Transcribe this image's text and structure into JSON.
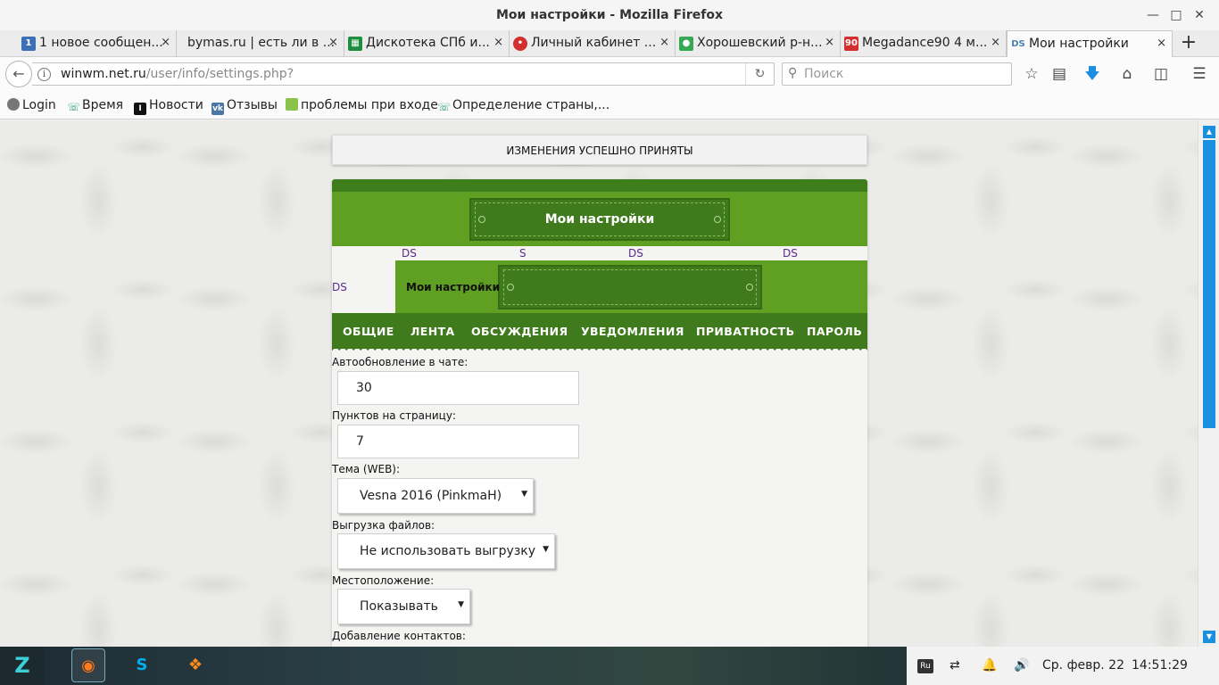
{
  "window": {
    "title": "Мои настройки - Mozilla Firefox",
    "minimize_icon": "minimize-icon",
    "maximize_icon": "maximize-icon",
    "close_icon": "close-icon"
  },
  "tabs": [
    {
      "label": "1 новое сообщен...",
      "favicon": "1",
      "favicon_color": "#3b6fb6"
    },
    {
      "label": "bymas.ru | есть ли в ...",
      "favicon": "",
      "favicon_color": ""
    },
    {
      "label": "Дискотека СПб и...",
      "favicon": "",
      "favicon_color": "#1e8e3e"
    },
    {
      "label": "Личный кабинет ...",
      "favicon": "",
      "favicon_color": "#d32f2f"
    },
    {
      "label": "Хорошевский р-н...",
      "favicon": "",
      "favicon_color": "#34a853"
    },
    {
      "label": "Megadance90 4 м...",
      "favicon": "90",
      "favicon_color": "#d32f2f"
    },
    {
      "label": "Мои настройки",
      "favicon": "DS",
      "favicon_color": "#4a7fb5",
      "active": true
    }
  ],
  "tab_close_glyph": "×",
  "new_tab_glyph": "+",
  "navbar": {
    "url_host": "winwm.net.ru",
    "url_path": "/user/info/settings.php?",
    "search_placeholder": "Поиск"
  },
  "bookmarks": [
    {
      "label": "Login",
      "icon": "globe-icon",
      "icon_color": "#777"
    },
    {
      "label": "Время",
      "icon": "phone-icon",
      "icon_color": "#2e9e6a"
    },
    {
      "label": "Новости",
      "icon": "i-icon",
      "icon_color": "#111"
    },
    {
      "label": "Отзывы",
      "icon": "vk-icon",
      "icon_color": "#4a76a8"
    },
    {
      "label": "проблемы при входе",
      "icon": "grid-icon",
      "icon_color": "#8bc34a"
    },
    {
      "label": "Определение страны,...",
      "icon": "phone-icon",
      "icon_color": "#2e9e6a"
    }
  ],
  "page": {
    "notice": "ИЗМЕНЕНИЯ УСПЕШНО ПРИНЯТЫ",
    "header_title": "Мои настройки",
    "ds_links": [
      "DS",
      "S",
      "DS",
      "DS",
      "DS"
    ],
    "sub_title": "Мои настройки",
    "menu": [
      "ОБЩИЕ",
      "ЛЕНТА",
      "ОБСУЖДЕНИЯ",
      "УВЕДОМЛЕНИЯ",
      "ПРИВАТНОСТЬ",
      "ПАРОЛЬ"
    ],
    "fields": {
      "autoupdate_label": "Автообновление в чате:",
      "autoupdate_value": "30",
      "per_page_label": "Пунктов на страницу:",
      "per_page_value": "7",
      "theme_label": "Тема (WEB):",
      "theme_value": "Vesna 2016 (PinkmaH)",
      "upload_label": "Выгрузка файлов:",
      "upload_value": "Не использовать выгрузку",
      "location_label": "Местоположение:",
      "location_value": "Показывать",
      "contacts_label": "Добавление контактов:"
    },
    "colors": {
      "green_light": "#5f9f22",
      "green_dark": "#3f7a1c",
      "link": "#5b2a8a"
    }
  },
  "taskbar": {
    "lang": "Ru",
    "date": "Ср. февр. 22",
    "time": "14:51:29"
  }
}
